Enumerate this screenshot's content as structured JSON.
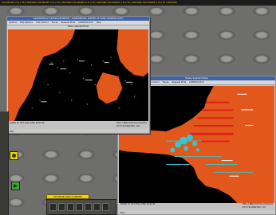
{
  "topbar": {
    "text": "TOP SECRET // SI // TK // NOFORN    TOP SECRET // SI // TK // NOFORN    TOP SECRET // SI // TK // NOFORN    TOP SECRET // SI // TK // NOFORN    TOP SECRET // SI // TK // NOFORN"
  },
  "window1": {
    "title": "CONFIDENTIAL (LIMITED) INTEREST - CONFIDENTIAL (EXCEPT AT SAME ADDRESS DATE)",
    "menu": [
      "Options",
      "Map Options",
      "Plot Control",
      "Tracks",
      "Request Plots",
      "CONTROL/SYS",
      "Help"
    ],
    "subtitle": "Notes: Selected Mode",
    "status_left": "ZOOM: 07 OCT 2011 (CFR) 03:02:35",
    "status_right_1": "TIM   11 NEW 0:05 AT 1/11/01/21",
    "status_right_2": "   10:37 01:0002 001 : 0:0",
    "exit": "EXIT"
  },
  "window2": {
    "title": "Notes: Selected Mode",
    "menu": [
      "Options",
      "Map Options",
      "Plot Control",
      "Tracks",
      "Request Plots",
      "CONTROL/SYS"
    ],
    "status_left": "ZOOM: 07 OCT 2011 (CFR) 03:02:35",
    "status_right_1": "TIM   11 NEW 0:05 AT 1/11/01/21",
    "status_right_2": "   10:37 01:0002 001 : 0:0",
    "exit": "EXIT"
  },
  "taskbar": {
    "label": "TOP SECRET NOFO OVERVIEW"
  },
  "colors": {
    "land": "#e2581c",
    "track": "#35c6d0",
    "track_red": "#e21e1e",
    "ocean": "#000000",
    "title_blue": "#3f62a8",
    "classification_yellow": "#f0d000"
  }
}
